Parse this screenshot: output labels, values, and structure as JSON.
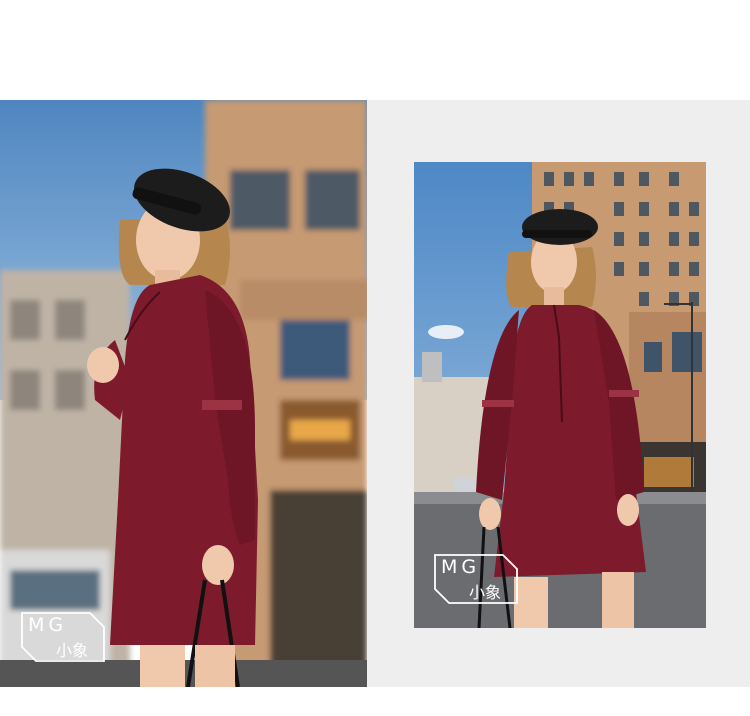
{
  "watermark": {
    "latin": "MG",
    "cjk": "小象"
  },
  "colors": {
    "page_background": "#ffffff",
    "panel_background": "#eeeeee",
    "dress": "#7d1a2c",
    "sky": "#5f93c8",
    "building": "#c79a72",
    "beret": "#1c1c1c",
    "hair": "#b5874e",
    "skin": "#f0c9ad"
  }
}
